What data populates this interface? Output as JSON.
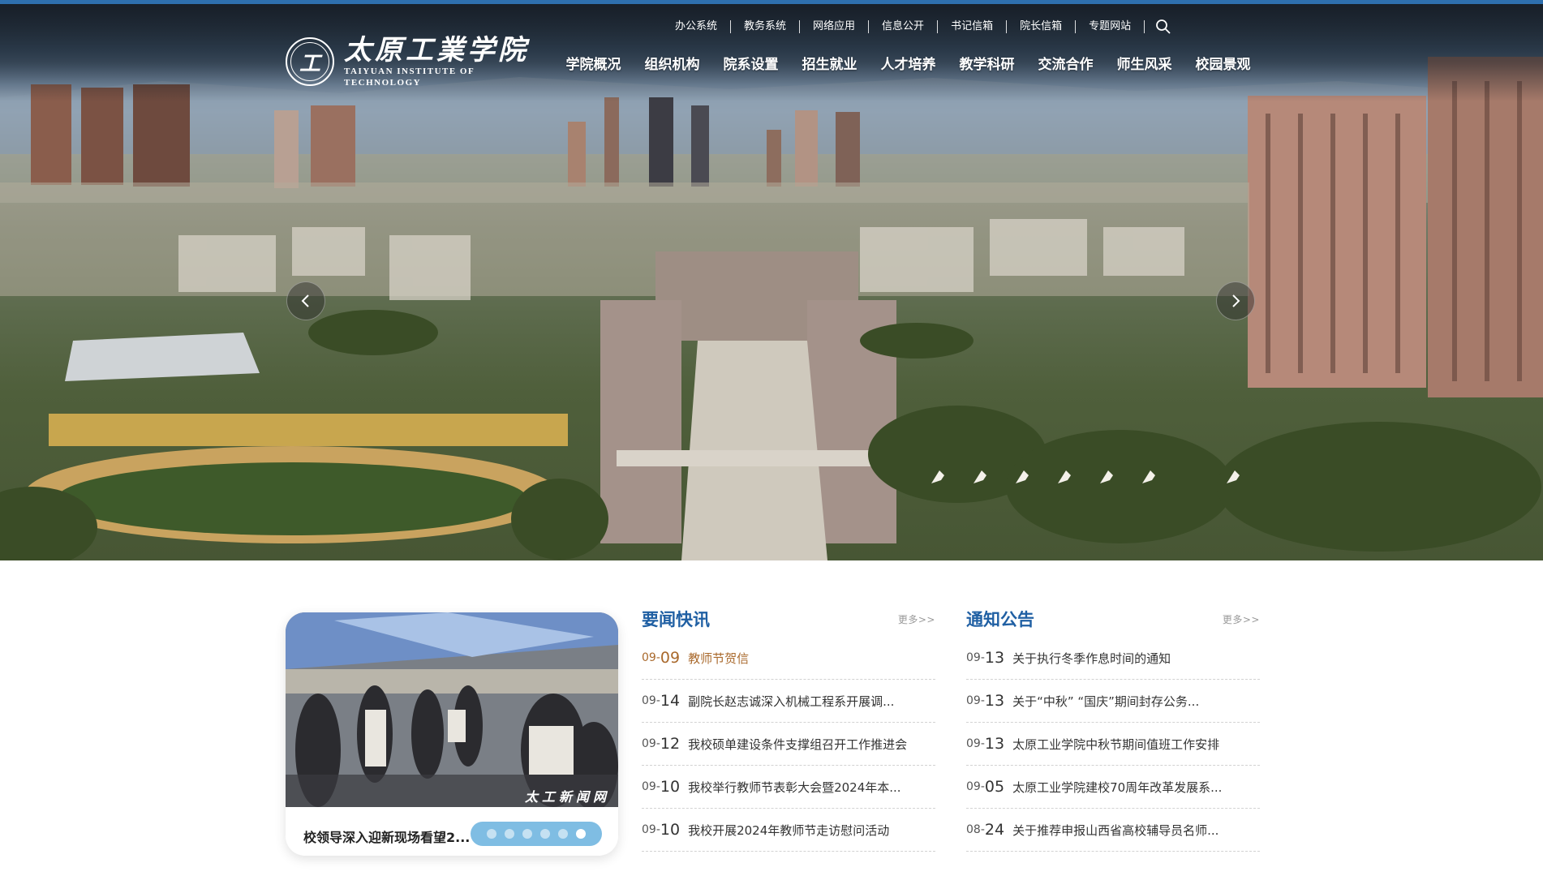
{
  "header": {
    "logo_cn": "太原工業学院",
    "logo_en": "TAIYUAN INSTITUTE OF TECHNOLOGY",
    "logo_seal_glyph": "工",
    "util_links": [
      "办公系统",
      "教务系统",
      "网络应用",
      "信息公开",
      "书记信箱",
      "院长信箱",
      "专题网站"
    ],
    "nav_items": [
      "学院概况",
      "组织机构",
      "院系设置",
      "招生就业",
      "人才培养",
      "教学科研",
      "交流合作",
      "师生风采",
      "校园景观"
    ]
  },
  "slider": {
    "icons": {
      "prev": "chevron-left-icon",
      "next": "chevron-right-icon",
      "search": "search-icon"
    }
  },
  "photo_news": {
    "caption": "校领导深入迎新现场看望2...",
    "watermark": "太工新闻网",
    "dots_count": 6,
    "active_dot": 6
  },
  "news": {
    "title": "要闻快讯",
    "more": "更多>>",
    "items": [
      {
        "month": "09-",
        "day": "09",
        "title": "教师节贺信",
        "highlight": true
      },
      {
        "month": "09-",
        "day": "14",
        "title": "副院长赵志诚深入机械工程系开展调..."
      },
      {
        "month": "09-",
        "day": "12",
        "title": "我校硕单建设条件支撑组召开工作推进会"
      },
      {
        "month": "09-",
        "day": "10",
        "title": "我校举行教师节表彰大会暨2024年本..."
      },
      {
        "month": "09-",
        "day": "10",
        "title": "我校开展2024年教师节走访慰问活动"
      }
    ]
  },
  "notices": {
    "title": "通知公告",
    "more": "更多>>",
    "items": [
      {
        "month": "09-",
        "day": "13",
        "title": "关于执行冬季作息时间的通知"
      },
      {
        "month": "09-",
        "day": "13",
        "title": "关于“中秋” “国庆”期间封存公务..."
      },
      {
        "month": "09-",
        "day": "13",
        "title": "太原工业学院中秋节期间值班工作安排"
      },
      {
        "month": "09-",
        "day": "05",
        "title": "太原工业学院建校70周年改革发展系..."
      },
      {
        "month": "08-",
        "day": "24",
        "title": "关于推荐申报山西省高校辅导员名师..."
      }
    ]
  },
  "colors": {
    "top_strip": "#2e6fae",
    "section_title": "#1f5fa3",
    "highlight_item": "#a9692c",
    "dots_bg": "#7fbde3"
  }
}
